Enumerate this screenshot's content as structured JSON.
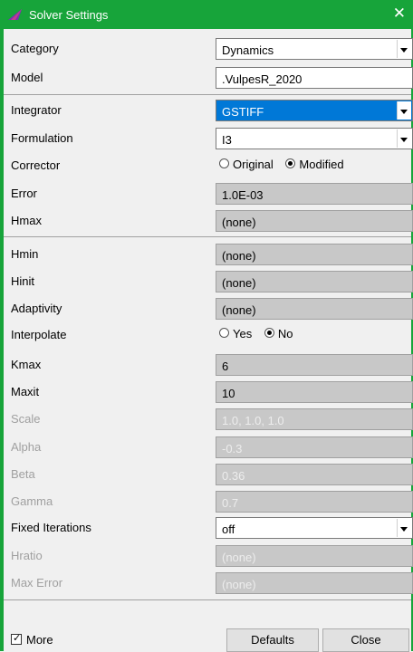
{
  "window": {
    "title": "Solver Settings",
    "close_symbol": "✕"
  },
  "rows": {
    "category": {
      "label": "Category",
      "value": "Dynamics"
    },
    "model": {
      "label": "Model",
      "value": ".VulpesR_2020"
    },
    "integrator": {
      "label": "Integrator",
      "value": "GSTIFF"
    },
    "formulation": {
      "label": "Formulation",
      "value": "I3"
    },
    "corrector": {
      "label": "Corrector",
      "options": [
        "Original",
        "Modified"
      ],
      "selected": "Modified"
    },
    "error": {
      "label": "Error",
      "value": "1.0E-03"
    },
    "hmax": {
      "label": "Hmax",
      "value": "(none)"
    },
    "hmin": {
      "label": "Hmin",
      "value": "(none)"
    },
    "hinit": {
      "label": "Hinit",
      "value": "(none)"
    },
    "adaptivity": {
      "label": "Adaptivity",
      "value": "(none)"
    },
    "interpolate": {
      "label": "Interpolate",
      "options": [
        "Yes",
        "No"
      ],
      "selected": "No"
    },
    "kmax": {
      "label": "Kmax",
      "value": "6"
    },
    "maxit": {
      "label": "Maxit",
      "value": "10"
    },
    "scale": {
      "label": "Scale",
      "value": "1.0, 1.0, 1.0"
    },
    "alpha": {
      "label": "Alpha",
      "value": "-0.3"
    },
    "beta": {
      "label": "Beta",
      "value": "0.36"
    },
    "gamma": {
      "label": "Gamma",
      "value": "0.7"
    },
    "fixed_iterations": {
      "label": "Fixed Iterations",
      "value": "off"
    },
    "hratio": {
      "label": "Hratio",
      "value": "(none)"
    },
    "max_error": {
      "label": "Max Error",
      "value": "(none)"
    }
  },
  "footer": {
    "more_label": "More",
    "more_checked": true,
    "check_mark": "✓",
    "defaults_label": "Defaults",
    "close_label": "Close"
  },
  "colors": {
    "titlebar": "#17a43a",
    "selection": "#0078d7",
    "readonly_field": "#c8c8c8"
  }
}
